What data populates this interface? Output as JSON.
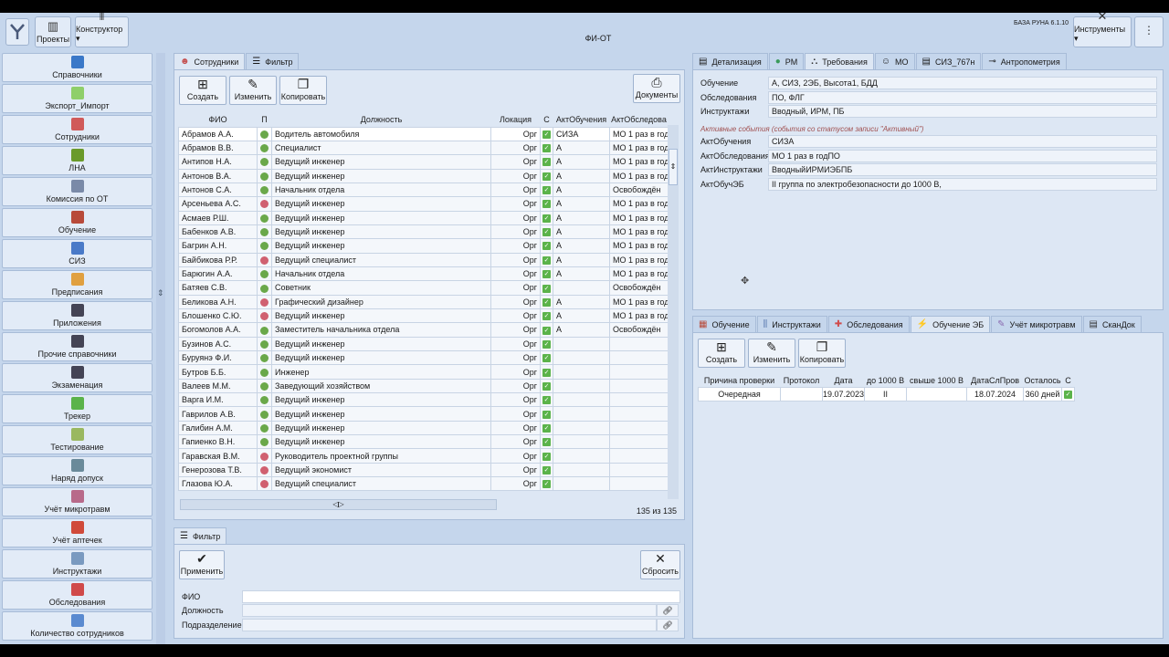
{
  "app": {
    "title": "ФИ-ОТ",
    "version": "БАЗА РУНА 6.1.10"
  },
  "toolbar": {
    "projects": "Проекты",
    "designer": "Конструктор",
    "tools": "Инструменты"
  },
  "sidebar": {
    "items": [
      {
        "label": "Справочники",
        "icon": "book-icon",
        "color": "#3a78c8"
      },
      {
        "label": "Экспорт_Импорт",
        "icon": "export-icon",
        "color": "#8fcf6a"
      },
      {
        "label": "Сотрудники",
        "icon": "people-icon",
        "color": "#d05a5a"
      },
      {
        "label": "ЛНА",
        "icon": "folder-icon",
        "color": "#6a9a2a"
      },
      {
        "label": "Комиссия по ОТ",
        "icon": "commission-icon",
        "color": "#7a8aa8"
      },
      {
        "label": "Обучение",
        "icon": "books-icon",
        "color": "#b84a3a"
      },
      {
        "label": "СИЗ",
        "icon": "ppe-icon",
        "color": "#4a7ac8"
      },
      {
        "label": "Предписания",
        "icon": "pencil-icon",
        "color": "#e0a040"
      },
      {
        "label": "Приложения",
        "icon": "window-icon",
        "color": "#445"
      },
      {
        "label": "Прочие справочники",
        "icon": "window-icon",
        "color": "#445"
      },
      {
        "label": "Экзаменация",
        "icon": "window-icon",
        "color": "#445"
      },
      {
        "label": "Трекер",
        "icon": "check-icon",
        "color": "#5bb34a"
      },
      {
        "label": "Тестирование",
        "icon": "test-icon",
        "color": "#9ab860"
      },
      {
        "label": "Наряд допуск",
        "icon": "permit-icon",
        "color": "#6a8a9a"
      },
      {
        "label": "Учёт микротравм",
        "icon": "bandage-icon",
        "color": "#b86a8a"
      },
      {
        "label": "Учёт аптечек",
        "icon": "first-aid-icon",
        "color": "#d04a3a"
      },
      {
        "label": "Инструктажи",
        "icon": "briefing-icon",
        "color": "#7a9ac0"
      },
      {
        "label": "Обследования",
        "icon": "medical-icon",
        "color": "#d04a4a"
      },
      {
        "label": "Количество сотрудников",
        "icon": "calendar-icon",
        "color": "#5a8ad0"
      }
    ]
  },
  "employees": {
    "tabs": [
      "Сотрудники",
      "Фильтр"
    ],
    "buttons": {
      "create": "Создать",
      "edit": "Изменить",
      "copy": "Копировать",
      "documents": "Документы"
    },
    "columns": [
      "ФИО",
      "П",
      "Должность",
      "Локация",
      "С",
      "АктОбучения",
      "АктОбследова"
    ],
    "rows": [
      [
        "Абрамов А.А.",
        "m",
        "Водитель автомобиля",
        "Орг",
        "СИЗА",
        "МО 1 раз в год"
      ],
      [
        "Абрамов В.В.",
        "m",
        "Специалист",
        "Орг",
        "А",
        "МО 1 раз в год"
      ],
      [
        "Антипов Н.А.",
        "m",
        "Ведущий инженер",
        "Орг",
        "А",
        "МО 1 раз в год"
      ],
      [
        "Антонов В.А.",
        "m",
        "Ведущий инженер",
        "Орг",
        "А",
        "МО 1 раз в год"
      ],
      [
        "Антонов С.А.",
        "m",
        "Начальник отдела",
        "Орг",
        "А",
        "Освобождён"
      ],
      [
        "Арсеньева А.С.",
        "f",
        "Ведущий инженер",
        "Орг",
        "А",
        "МО 1 раз в год"
      ],
      [
        "Асмаев Р.Ш.",
        "m",
        "Ведущий инженер",
        "Орг",
        "А",
        "МО 1 раз в год"
      ],
      [
        "Бабенков А.В.",
        "m",
        "Ведущий инженер",
        "Орг",
        "А",
        "МО 1 раз в год"
      ],
      [
        "Багрин А.Н.",
        "m",
        "Ведущий инженер",
        "Орг",
        "А",
        "МО 1 раз в год"
      ],
      [
        "Байбикова Р.Р.",
        "f",
        "Ведущий специалист",
        "Орг",
        "А",
        "МО 1 раз в год"
      ],
      [
        "Барюгин А.А.",
        "m",
        "Начальник отдела",
        "Орг",
        "А",
        "МО 1 раз в год"
      ],
      [
        "Батяев С.В.",
        "m",
        "Советник",
        "Орг",
        "",
        "Освобождён"
      ],
      [
        "Беликова А.Н.",
        "f",
        "Графический дизайнер",
        "Орг",
        "А",
        "МО 1 раз в год"
      ],
      [
        "Блошенко С.Ю.",
        "f",
        "Ведущий инженер",
        "Орг",
        "А",
        "МО 1 раз в год"
      ],
      [
        "Богомолов А.А.",
        "m",
        "Заместитель начальника отдела",
        "Орг",
        "А",
        "Освобождён"
      ],
      [
        "Бузинов А.С.",
        "m",
        "Ведущий инженер",
        "Орг",
        "",
        ""
      ],
      [
        "Буруянэ Ф.И.",
        "m",
        "Ведущий инженер",
        "Орг",
        "",
        ""
      ],
      [
        "Бутров Б.Б.",
        "m",
        "Инженер",
        "Орг",
        "",
        ""
      ],
      [
        "Валеев М.М.",
        "m",
        "Заведующий хозяйством",
        "Орг",
        "",
        ""
      ],
      [
        "Варга И.М.",
        "m",
        "Ведущий инженер",
        "Орг",
        "",
        ""
      ],
      [
        "Гаврилов А.В.",
        "m",
        "Ведущий инженер",
        "Орг",
        "",
        ""
      ],
      [
        "Галибин А.М.",
        "m",
        "Ведущий инженер",
        "Орг",
        "",
        ""
      ],
      [
        "Гапиенко В.Н.",
        "m",
        "Ведущий инженер",
        "Орг",
        "",
        ""
      ],
      [
        "Гаравская В.М.",
        "f",
        "Руководитель проектной группы",
        "Орг",
        "",
        ""
      ],
      [
        "Генерозова Т.В.",
        "f",
        "Ведущий экономист",
        "Орг",
        "",
        ""
      ],
      [
        "Глазова Ю.А.",
        "f",
        "Ведущий специалист",
        "Орг",
        "",
        ""
      ]
    ],
    "count": "135 из 135"
  },
  "filter": {
    "title": "Фильтр",
    "apply": "Применить",
    "reset": "Сбросить",
    "fields": [
      "ФИО",
      "Должность",
      "Подразделение"
    ]
  },
  "details": {
    "tabs": [
      "Детализация",
      "РМ",
      "Требования",
      "МО",
      "СИЗ_767н",
      "Антропометрия"
    ],
    "requirements": [
      {
        "label": "Обучение",
        "value": "А, СИЗ, 2ЭБ, Высота1, БДД"
      },
      {
        "label": "Обследования",
        "value": "ПО, ФЛГ"
      },
      {
        "label": "Инструктажи",
        "value": "Вводный, ИРМ, ПБ"
      }
    ],
    "active_note": "Активные события (события со статусом записи \"Активный\")",
    "active": [
      {
        "label": "АктОбучения",
        "value": "СИЗА"
      },
      {
        "label": "АктОбследования",
        "value": "МО 1 раз в годПО"
      },
      {
        "label": "АктИнструктажи",
        "value": "ВводныйИРМИЭБПБ"
      },
      {
        "label": "АктОбучЭБ",
        "value": "II группа по электробезопасности до 1000 В,"
      }
    ]
  },
  "lower": {
    "tabs": [
      "Обучение",
      "Инструктажи",
      "Обследования",
      "Обучение ЭБ",
      "Учёт микротравм",
      "СканДок"
    ],
    "buttons": {
      "create": "Создать",
      "edit": "Изменить",
      "copy": "Копировать"
    },
    "columns": [
      "Причина проверки",
      "Протокол",
      "Дата",
      "до 1000 В",
      "свыше 1000 В",
      "ДатаСлПров",
      "Осталось",
      "С"
    ],
    "rows": [
      [
        "Очередная",
        "",
        "19.07.2023",
        "II",
        "",
        "18.07.2024",
        "360 дней"
      ]
    ]
  }
}
